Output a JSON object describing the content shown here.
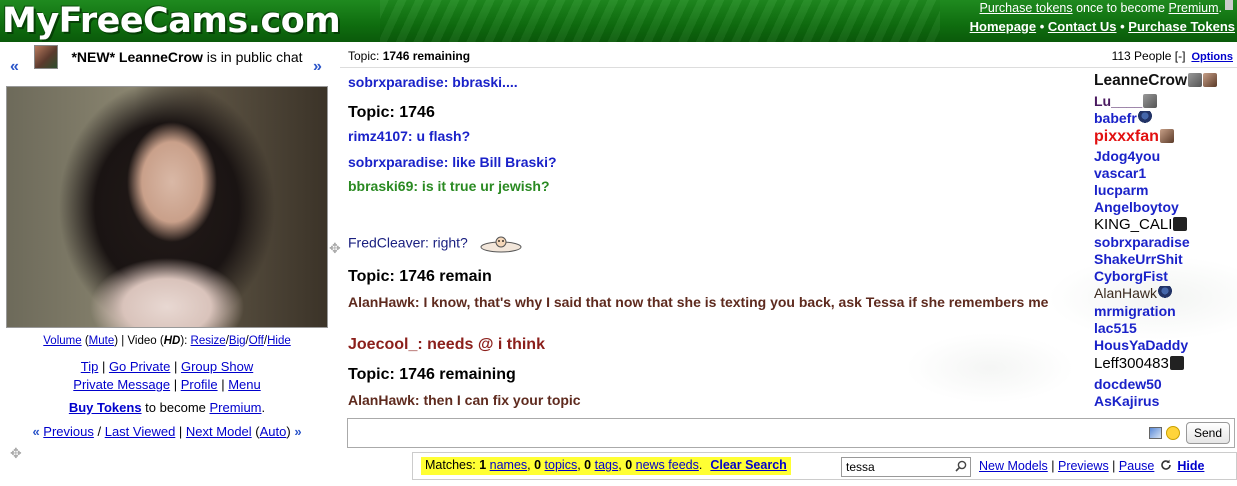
{
  "header": {
    "logo": "MyFreeCams.com",
    "promo_link": "Purchase tokens",
    "promo_text": " once to become ",
    "promo_premium": "Premium",
    "promo_end": ".",
    "nav": [
      "Homepage",
      "Contact Us",
      "Purchase Tokens"
    ],
    "nav_sep": " • "
  },
  "model": {
    "prefix": "*NEW* LeanneCrow",
    "status": " is in public chat",
    "arrow_left": "«",
    "arrow_right": "»",
    "controls": {
      "volume": "Volume",
      "mute": "Mute",
      "video_label": "Video (",
      "hd": "HD",
      "video_end": "):",
      "resize": "Resize",
      "big": "Big",
      "off": "Off",
      "hide": "Hide"
    },
    "links_row1": [
      "Tip",
      "Go Private",
      "Group Show"
    ],
    "links_row2": [
      "Private Message",
      "Profile",
      "Menu"
    ],
    "buy_tokens": "Buy Tokens",
    "buy_text": " to become ",
    "buy_premium": "Premium",
    "buy_end": ".",
    "nav": {
      "previous": "Previous",
      "last_viewed": "Last Viewed",
      "next_model": "Next Model",
      "auto": "Auto"
    }
  },
  "chat": {
    "topic_label": "Topic: ",
    "topic_value": "1746 remaining",
    "people_count": "113 People",
    "collapse": "[-]",
    "options": "Options",
    "messages": [
      {
        "text": "sobrxparadise: bbraski....",
        "style": "blue"
      },
      {
        "text": "Topic: 1746",
        "style": "topicline"
      },
      {
        "text": "rimz4107: u flash?",
        "style": "blue"
      },
      {
        "text": "sobrxparadise: like Bill Braski?",
        "style": "blue"
      },
      {
        "text": "bbraski69: is it true ur jewish?",
        "style": "green"
      },
      {
        "text": "FredCleaver: right?",
        "style": "plain"
      },
      {
        "text": "Topic: 1746 remain",
        "style": "topicline"
      },
      {
        "text": "AlanHawk: I know, that's why I said that now that she is texting you back, ask Tessa if she remembers me",
        "style": "brown"
      },
      {
        "text": "Joecool_: needs @ i think",
        "style": "big"
      },
      {
        "text": "Topic: 1746 remaining",
        "style": "topicline"
      },
      {
        "text": "AlanHawk: then I can fix your topic",
        "style": "brown"
      }
    ],
    "send_label": "Send"
  },
  "users": [
    {
      "name": "LeanneCrow",
      "style": "top",
      "icon": "photo"
    },
    {
      "name": "Lu____",
      "style": "dark",
      "icon": "cam"
    },
    {
      "name": "babefr",
      "style": "blue",
      "icon": "avatar"
    },
    {
      "name": "pixxxfan",
      "style": "red",
      "icon": "photo"
    },
    {
      "name": "Jdog4you",
      "style": "blue",
      "icon": ""
    },
    {
      "name": "vascar1",
      "style": "blue",
      "icon": ""
    },
    {
      "name": "lucparm",
      "style": "blue",
      "icon": ""
    },
    {
      "name": "Angelboytoy",
      "style": "blue",
      "icon": ""
    },
    {
      "name": "KING_CALI",
      "style": "black",
      "icon": "dark"
    },
    {
      "name": "sobrxparadise",
      "style": "blue",
      "icon": ""
    },
    {
      "name": "ShakeUrrShit",
      "style": "blue",
      "icon": ""
    },
    {
      "name": "CyborgFist",
      "style": "blue",
      "icon": ""
    },
    {
      "name": "AlanHawk",
      "style": "brown",
      "icon": "avatar"
    },
    {
      "name": "mrmigration",
      "style": "blue",
      "icon": ""
    },
    {
      "name": "lac515",
      "style": "blue",
      "icon": ""
    },
    {
      "name": "HousYaDaddy",
      "style": "blue",
      "icon": ""
    },
    {
      "name": "Leff300483",
      "style": "black",
      "icon": "dark"
    },
    {
      "name": "docdew50",
      "style": "blue",
      "icon": ""
    },
    {
      "name": "AsKajirus",
      "style": "blue",
      "icon": ""
    }
  ],
  "bottom": {
    "matches_label": "Matches: ",
    "n_names": "1",
    "names": "names",
    "n_topics": "0",
    "topics": "topics",
    "n_tags": "0",
    "tags": "tags",
    "n_news": "0",
    "news": "news feeds",
    "clear_search": "Clear Search",
    "search_value": "tessa",
    "new_models": "New Models",
    "previews": "Previews",
    "pause": "Pause",
    "hide": "Hide"
  },
  "colors": {
    "header_green": "#127a12",
    "link_blue": "#0000cc",
    "match_yellow": "#ffff33"
  }
}
